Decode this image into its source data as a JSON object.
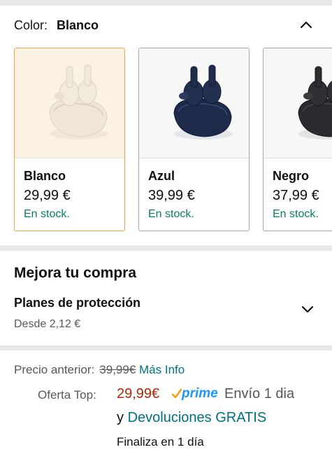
{
  "color_selector": {
    "label": "Color:",
    "selected": "Blanco",
    "options": [
      {
        "name": "Blanco",
        "price": "29,99 €",
        "stock": "En stock.",
        "color": "#f2ece0"
      },
      {
        "name": "Azul",
        "price": "39,99 €",
        "stock": "En stock.",
        "color": "#1d2a4a"
      },
      {
        "name": "Negro",
        "price": "37,99 €",
        "stock": "En stock.",
        "color": "#2a2b2e"
      }
    ]
  },
  "upgrade": {
    "title": "Mejora tu compra",
    "plan_title": "Planes de protección",
    "plan_price": "Desde 2,12 €"
  },
  "pricing": {
    "previous_label": "Precio anterior:",
    "previous_price": "39,99€",
    "more_info": "Más Info",
    "deal_label": "Oferta Top:",
    "deal_price": "29,99€",
    "prime_label": "prime",
    "shipping": "Envío 1 dia",
    "and_word": "y",
    "returns": "Devoluciones GRATIS",
    "ends": "Finaliza en 1 día"
  },
  "colors": {
    "link": "#007185",
    "deal": "#b12704",
    "stock": "#067d62",
    "prime": "#1a98ff",
    "selected_border": "#e8a64c"
  }
}
